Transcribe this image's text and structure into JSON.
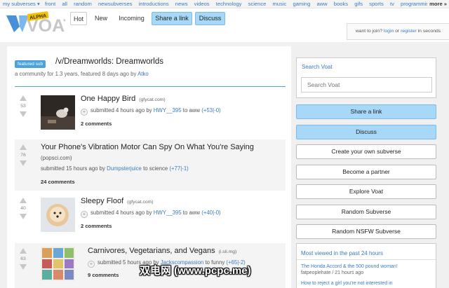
{
  "topbar": {
    "my_subverses": "my subverses ▾",
    "links": [
      "front",
      "all",
      "random"
    ],
    "subverses": [
      "newsubverses",
      "introductions",
      "news",
      "videos",
      "technology",
      "science",
      "music",
      "gaming",
      "aww",
      "books",
      "gifs",
      "sports",
      "tv",
      "programming"
    ],
    "more": "more »"
  },
  "header": {
    "logo_text": "VOAT",
    "logo_badge": "ALPHA",
    "tabs": {
      "hot": "Hot",
      "new": "New",
      "incoming": "Incoming"
    },
    "share_link": "Share a link",
    "discuss": "Discuss",
    "join_prefix": "want to join?",
    "login": "login",
    "join_or": "or",
    "register": "register",
    "join_suffix": "in seconds"
  },
  "featured": {
    "badge": "featured sub",
    "title": "/v/Dreamworlds: Dreamworlds",
    "sub_prefix": "a community for 1.3 years, featured 8 days ago by",
    "sub_user": "Atko"
  },
  "posts": [
    {
      "score": "53",
      "title": "One Happy Bird",
      "domain": "(gfycat.com)",
      "submitted": "submitted 4 hours ago by",
      "user": "HWY__395",
      "to": "to",
      "sub": "aww",
      "votes": "(+53|-0)",
      "comments": "2 comments"
    },
    {
      "score": "76",
      "title": "Your Phone's Vibration Motor Can Spy On What You're Saying",
      "domain": "(popsci.com)",
      "submitted": "submitted 15 hours ago by",
      "user": "Dumpsterjuice",
      "to": "to",
      "sub": "science",
      "votes": "(+77|-1)",
      "comments": "24 comments"
    },
    {
      "score": "40",
      "title": "Sleepy Floof",
      "domain": "(gfycat.com)",
      "submitted": "submitted 4 hours ago by",
      "user": "HWY__395",
      "to": "to",
      "sub": "aww",
      "votes": "(+40|-0)",
      "comments": "2 comments"
    },
    {
      "score": "63",
      "title": "Carnivores, Vegetarians, and Vegans",
      "domain": "(i.sli.mg)",
      "submitted": "submitted 5 hours ago by",
      "user": "Jackscompassion",
      "to": "to",
      "sub": "funny",
      "votes": "(+65|-2)",
      "comments": "9 comments"
    }
  ],
  "sidebar": {
    "search_label": "Search Voat",
    "search_placeholder": "Search Voat",
    "share_link": "Share a link",
    "discuss": "Discuss",
    "create_subverse": "Create your own subverse",
    "become_partner": "Become a partner",
    "explore": "Explore Voat",
    "random_subverse": "Random Subverse",
    "random_nsfw": "Random NSFW Subverse",
    "most_viewed_title": "Most viewed in the past 24 hours",
    "most_viewed": [
      {
        "title": "The Honda Accord & the 500 pound woman!",
        "meta": "fatpeoplehate / 21 hours ago"
      },
      {
        "title": "How to reject a girl you're not interested in",
        "meta": ""
      }
    ]
  },
  "watermark": "双电网 (www.pcpc.me)",
  "colors": {
    "accent_blue": "#4aa3df",
    "button_blue": "#a8d8f7",
    "link_blue": "#3b7bbf"
  }
}
